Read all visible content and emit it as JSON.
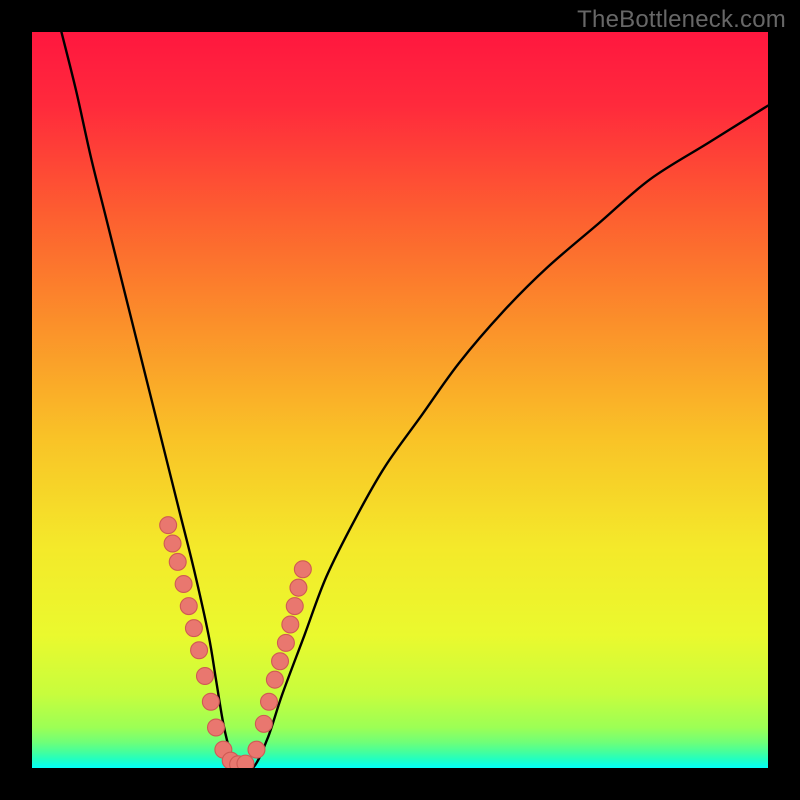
{
  "watermark": "TheBottleneck.com",
  "colors": {
    "frame": "#000000",
    "watermark": "#676767",
    "curve": "#000000",
    "marker_fill": "#e9776f",
    "marker_stroke": "#cf5a54",
    "gradient_stops": [
      {
        "offset": 0.0,
        "color": "#ff173f"
      },
      {
        "offset": 0.1,
        "color": "#ff2a3c"
      },
      {
        "offset": 0.25,
        "color": "#fd5f30"
      },
      {
        "offset": 0.4,
        "color": "#fb912a"
      },
      {
        "offset": 0.55,
        "color": "#f9c227"
      },
      {
        "offset": 0.7,
        "color": "#f4e92a"
      },
      {
        "offset": 0.82,
        "color": "#eaf92e"
      },
      {
        "offset": 0.9,
        "color": "#c7fd3d"
      },
      {
        "offset": 0.945,
        "color": "#9cff55"
      },
      {
        "offset": 0.965,
        "color": "#6fff78"
      },
      {
        "offset": 0.978,
        "color": "#45ff9c"
      },
      {
        "offset": 0.988,
        "color": "#22ffc0"
      },
      {
        "offset": 0.995,
        "color": "#0fffe0"
      },
      {
        "offset": 1.0,
        "color": "#03fff9"
      }
    ]
  },
  "chart_data": {
    "type": "line",
    "title": "",
    "xlabel": "",
    "ylabel": "",
    "xlim": [
      0,
      100
    ],
    "ylim": [
      0,
      100
    ],
    "series": [
      {
        "name": "bottleneck-curve",
        "x": [
          4,
          6,
          8,
          10,
          12,
          14,
          16,
          18,
          20,
          22,
          24,
          25,
          26,
          27,
          28,
          30,
          32,
          34,
          37,
          40,
          44,
          48,
          53,
          58,
          64,
          70,
          77,
          84,
          92,
          100
        ],
        "y": [
          100,
          92,
          83,
          75,
          67,
          59,
          51,
          43,
          35,
          27,
          18,
          12,
          6,
          2,
          0,
          0,
          4,
          10,
          18,
          26,
          34,
          41,
          48,
          55,
          62,
          68,
          74,
          80,
          85,
          90
        ]
      }
    ],
    "markers": {
      "name": "highlighted-points",
      "x": [
        18.5,
        19.1,
        19.8,
        20.6,
        21.3,
        22.0,
        22.7,
        23.5,
        24.3,
        25.0,
        26.0,
        27.0,
        28.0,
        29.0,
        30.5,
        31.5,
        32.2,
        33.0,
        33.7,
        34.5,
        35.1,
        35.7,
        36.2,
        36.8
      ],
      "y": [
        33.0,
        30.5,
        28.0,
        25.0,
        22.0,
        19.0,
        16.0,
        12.5,
        9.0,
        5.5,
        2.5,
        1.0,
        0.5,
        0.6,
        2.5,
        6.0,
        9.0,
        12.0,
        14.5,
        17.0,
        19.5,
        22.0,
        24.5,
        27.0
      ]
    }
  }
}
